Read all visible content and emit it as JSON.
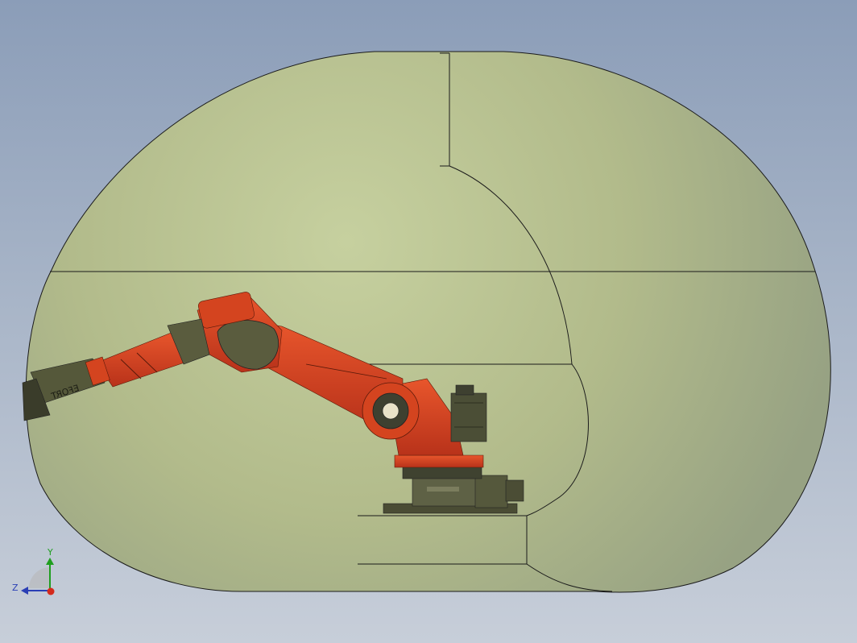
{
  "view": {
    "background_top": "#8b9db8",
    "background_bottom": "#c7ced9",
    "envelope_fill": "#c8d39c",
    "edge_color": "#1a1a1a"
  },
  "model": {
    "robot_color": "#d8401e",
    "robot_dark": "#55583a",
    "arm_label_text": "EFORT"
  },
  "triad": {
    "y_label": "Y",
    "z_label": "Z",
    "y_color": "#1f9e1f",
    "z_color": "#2a3fb5",
    "x_color": "#d42a1c"
  }
}
